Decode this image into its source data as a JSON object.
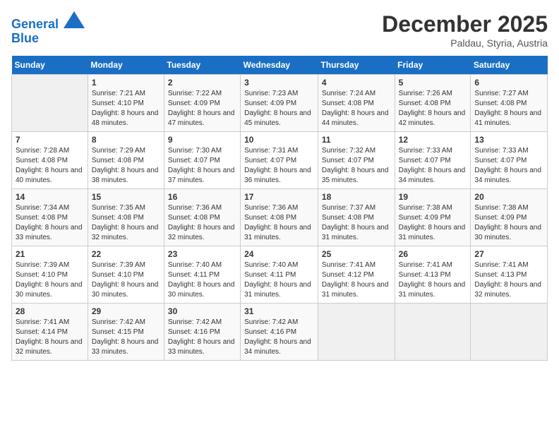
{
  "header": {
    "logo_line1": "General",
    "logo_line2": "Blue",
    "month": "December 2025",
    "location": "Paldau, Styria, Austria"
  },
  "days_of_week": [
    "Sunday",
    "Monday",
    "Tuesday",
    "Wednesday",
    "Thursday",
    "Friday",
    "Saturday"
  ],
  "weeks": [
    [
      {
        "day": "",
        "empty": true
      },
      {
        "day": "1",
        "sunrise": "7:21 AM",
        "sunset": "4:10 PM",
        "daylight": "8 hours and 48 minutes."
      },
      {
        "day": "2",
        "sunrise": "7:22 AM",
        "sunset": "4:09 PM",
        "daylight": "8 hours and 47 minutes."
      },
      {
        "day": "3",
        "sunrise": "7:23 AM",
        "sunset": "4:09 PM",
        "daylight": "8 hours and 45 minutes."
      },
      {
        "day": "4",
        "sunrise": "7:24 AM",
        "sunset": "4:08 PM",
        "daylight": "8 hours and 44 minutes."
      },
      {
        "day": "5",
        "sunrise": "7:26 AM",
        "sunset": "4:08 PM",
        "daylight": "8 hours and 42 minutes."
      },
      {
        "day": "6",
        "sunrise": "7:27 AM",
        "sunset": "4:08 PM",
        "daylight": "8 hours and 41 minutes."
      }
    ],
    [
      {
        "day": "7",
        "sunrise": "7:28 AM",
        "sunset": "4:08 PM",
        "daylight": "8 hours and 40 minutes."
      },
      {
        "day": "8",
        "sunrise": "7:29 AM",
        "sunset": "4:08 PM",
        "daylight": "8 hours and 38 minutes."
      },
      {
        "day": "9",
        "sunrise": "7:30 AM",
        "sunset": "4:07 PM",
        "daylight": "8 hours and 37 minutes."
      },
      {
        "day": "10",
        "sunrise": "7:31 AM",
        "sunset": "4:07 PM",
        "daylight": "8 hours and 36 minutes."
      },
      {
        "day": "11",
        "sunrise": "7:32 AM",
        "sunset": "4:07 PM",
        "daylight": "8 hours and 35 minutes."
      },
      {
        "day": "12",
        "sunrise": "7:33 AM",
        "sunset": "4:07 PM",
        "daylight": "8 hours and 34 minutes."
      },
      {
        "day": "13",
        "sunrise": "7:33 AM",
        "sunset": "4:07 PM",
        "daylight": "8 hours and 34 minutes."
      }
    ],
    [
      {
        "day": "14",
        "sunrise": "7:34 AM",
        "sunset": "4:08 PM",
        "daylight": "8 hours and 33 minutes."
      },
      {
        "day": "15",
        "sunrise": "7:35 AM",
        "sunset": "4:08 PM",
        "daylight": "8 hours and 32 minutes."
      },
      {
        "day": "16",
        "sunrise": "7:36 AM",
        "sunset": "4:08 PM",
        "daylight": "8 hours and 32 minutes."
      },
      {
        "day": "17",
        "sunrise": "7:36 AM",
        "sunset": "4:08 PM",
        "daylight": "8 hours and 31 minutes."
      },
      {
        "day": "18",
        "sunrise": "7:37 AM",
        "sunset": "4:08 PM",
        "daylight": "8 hours and 31 minutes."
      },
      {
        "day": "19",
        "sunrise": "7:38 AM",
        "sunset": "4:09 PM",
        "daylight": "8 hours and 31 minutes."
      },
      {
        "day": "20",
        "sunrise": "7:38 AM",
        "sunset": "4:09 PM",
        "daylight": "8 hours and 30 minutes."
      }
    ],
    [
      {
        "day": "21",
        "sunrise": "7:39 AM",
        "sunset": "4:10 PM",
        "daylight": "8 hours and 30 minutes."
      },
      {
        "day": "22",
        "sunrise": "7:39 AM",
        "sunset": "4:10 PM",
        "daylight": "8 hours and 30 minutes."
      },
      {
        "day": "23",
        "sunrise": "7:40 AM",
        "sunset": "4:11 PM",
        "daylight": "8 hours and 30 minutes."
      },
      {
        "day": "24",
        "sunrise": "7:40 AM",
        "sunset": "4:11 PM",
        "daylight": "8 hours and 31 minutes."
      },
      {
        "day": "25",
        "sunrise": "7:41 AM",
        "sunset": "4:12 PM",
        "daylight": "8 hours and 31 minutes."
      },
      {
        "day": "26",
        "sunrise": "7:41 AM",
        "sunset": "4:13 PM",
        "daylight": "8 hours and 31 minutes."
      },
      {
        "day": "27",
        "sunrise": "7:41 AM",
        "sunset": "4:13 PM",
        "daylight": "8 hours and 32 minutes."
      }
    ],
    [
      {
        "day": "28",
        "sunrise": "7:41 AM",
        "sunset": "4:14 PM",
        "daylight": "8 hours and 32 minutes."
      },
      {
        "day": "29",
        "sunrise": "7:42 AM",
        "sunset": "4:15 PM",
        "daylight": "8 hours and 33 minutes."
      },
      {
        "day": "30",
        "sunrise": "7:42 AM",
        "sunset": "4:16 PM",
        "daylight": "8 hours and 33 minutes."
      },
      {
        "day": "31",
        "sunrise": "7:42 AM",
        "sunset": "4:16 PM",
        "daylight": "8 hours and 34 minutes."
      },
      {
        "day": "",
        "empty": true
      },
      {
        "day": "",
        "empty": true
      },
      {
        "day": "",
        "empty": true
      }
    ]
  ]
}
